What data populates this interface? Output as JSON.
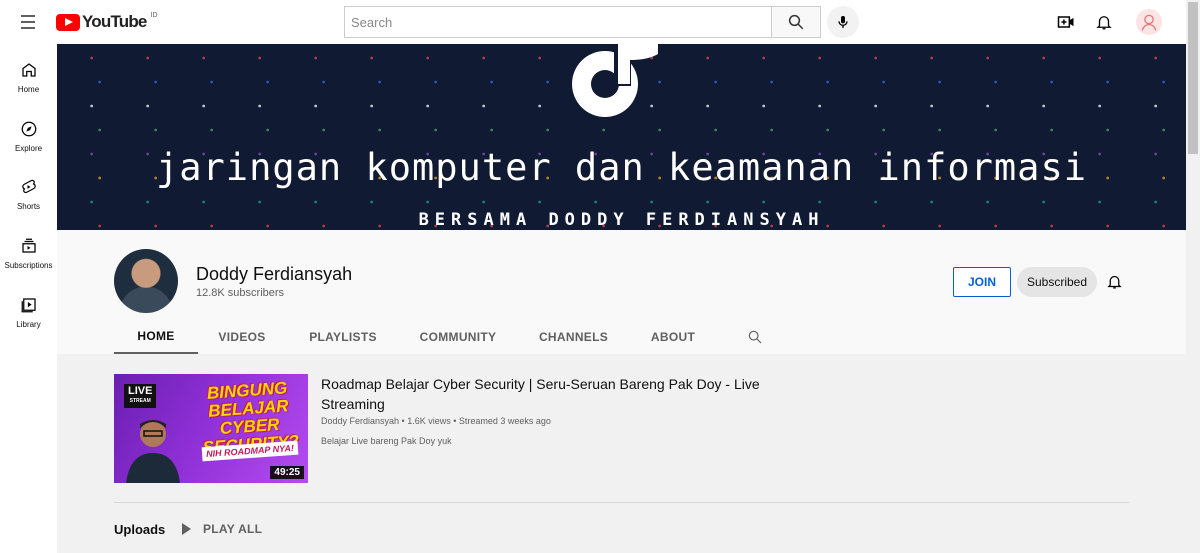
{
  "header": {
    "logo_text": "YouTube",
    "country": "ID",
    "search_placeholder": "Search"
  },
  "sidebar": {
    "items": [
      {
        "label": "Home",
        "icon": "home-icon"
      },
      {
        "label": "Explore",
        "icon": "compass-icon"
      },
      {
        "label": "Shorts",
        "icon": "shorts-icon"
      },
      {
        "label": "Subscriptions",
        "icon": "subscriptions-icon"
      },
      {
        "label": "Library",
        "icon": "library-icon"
      }
    ]
  },
  "banner": {
    "title": "jaringan komputer dan keamanan informasi",
    "subtitle": "BERSAMA DODDY FERDIANSYAH"
  },
  "channel": {
    "name": "Doddy Ferdiansyah",
    "subscribers": "12.8K subscribers",
    "join_label": "JOIN",
    "subscribed_label": "Subscribed"
  },
  "tabs": [
    {
      "label": "HOME",
      "active": true
    },
    {
      "label": "VIDEOS",
      "active": false
    },
    {
      "label": "PLAYLISTS",
      "active": false
    },
    {
      "label": "COMMUNITY",
      "active": false
    },
    {
      "label": "CHANNELS",
      "active": false
    },
    {
      "label": "ABOUT",
      "active": false
    }
  ],
  "featured_video": {
    "title": "Roadmap Belajar Cyber Security | Seru-Seruan Bareng Pak Doy - Live Streaming",
    "meta": "Doddy Ferdiansyah • 1.6K views • Streamed 3 weeks ago",
    "description": "Belajar Live bareng Pak Doy yuk",
    "duration": "49:25",
    "thumb_live": "LIVE",
    "thumb_live_sub": "STREAM",
    "thumb_text": "BINGUNG BELAJAR CYBER SECURITY?",
    "thumb_strip": "NIH ROADMAP NYA!"
  },
  "uploads": {
    "label": "Uploads",
    "play_all": "PLAY ALL"
  },
  "colors": {
    "brand_red": "#ff0000",
    "link_blue": "#065fd4",
    "banner_bg": "#101a33"
  }
}
